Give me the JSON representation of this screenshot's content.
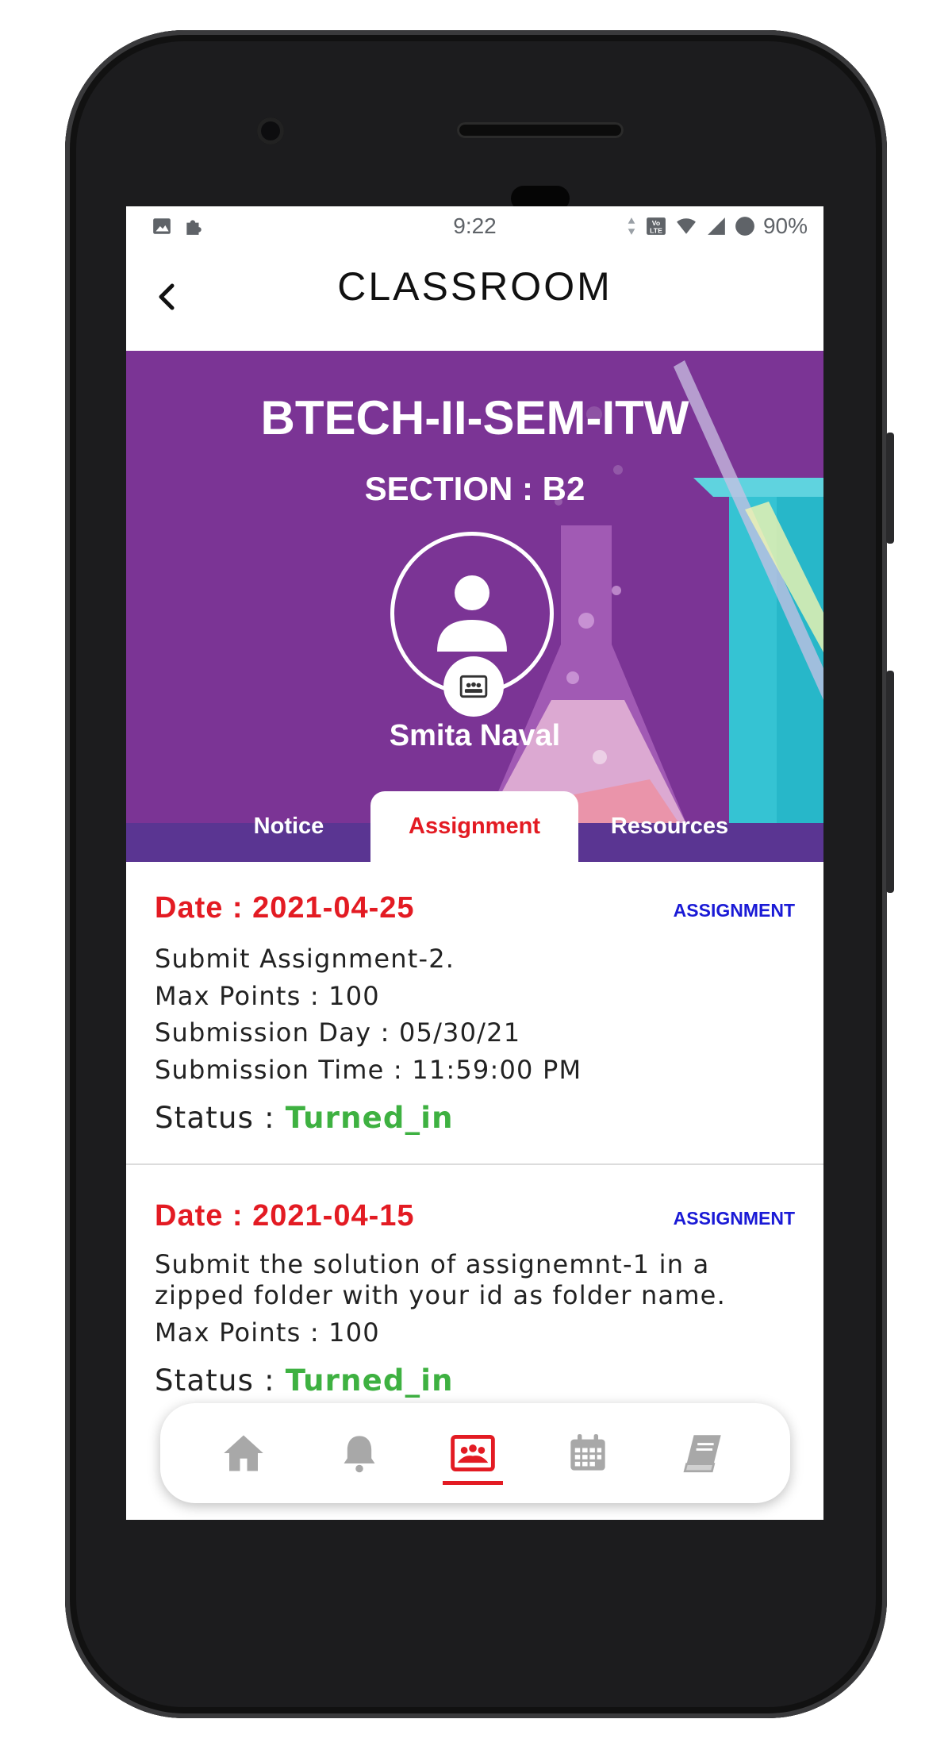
{
  "status_bar": {
    "time": "9:22",
    "battery": "90%",
    "left_icons": [
      "image-icon",
      "puzzle-icon"
    ],
    "right_icons": [
      "data-arrows-icon",
      "volte-icon",
      "wifi-icon",
      "signal-icon",
      "battery-icon"
    ]
  },
  "app_bar": {
    "title": "CLASSROOM",
    "back_icon": "chevron-left-icon"
  },
  "class_header": {
    "class_name": "BTECH-II-SEM-ITW",
    "section": "SECTION : B2",
    "teacher_name": "Smita Naval",
    "avatar_icon": "person-icon",
    "badge_icon": "classroom-icon"
  },
  "tabs": [
    {
      "label": "Notice",
      "active": false
    },
    {
      "label": "Assignment",
      "active": true
    },
    {
      "label": "Resources",
      "active": false
    }
  ],
  "assignments": [
    {
      "date": "Date : 2021-04-25",
      "type": "ASSIGNMENT",
      "lines": [
        "Submit Assignment-2.",
        "Max Points : 100",
        "Submission Day : 05/30/21",
        "Submission Time : 11:59:00 PM"
      ],
      "status_label": "Status : ",
      "status_value": "Turned_in"
    },
    {
      "date": "Date : 2021-04-15",
      "type": "ASSIGNMENT",
      "lines": [
        "Submit the solution of assignemnt-1 in a",
        "zipped folder with your id as folder name.",
        "Max Points : 100"
      ],
      "status_label": "Status : ",
      "status_value": "Turned_in"
    }
  ],
  "bottom_nav": [
    {
      "icon": "home-icon",
      "active": false
    },
    {
      "icon": "bell-icon",
      "active": false
    },
    {
      "icon": "classroom-icon",
      "active": true
    },
    {
      "icon": "calendar-icon",
      "active": false
    },
    {
      "icon": "book-icon",
      "active": false
    }
  ],
  "colors": {
    "accent_red": "#e31b23",
    "banner_purple": "#7b3495",
    "status_green": "#3eb141",
    "type_blue": "#1a1ad6"
  }
}
